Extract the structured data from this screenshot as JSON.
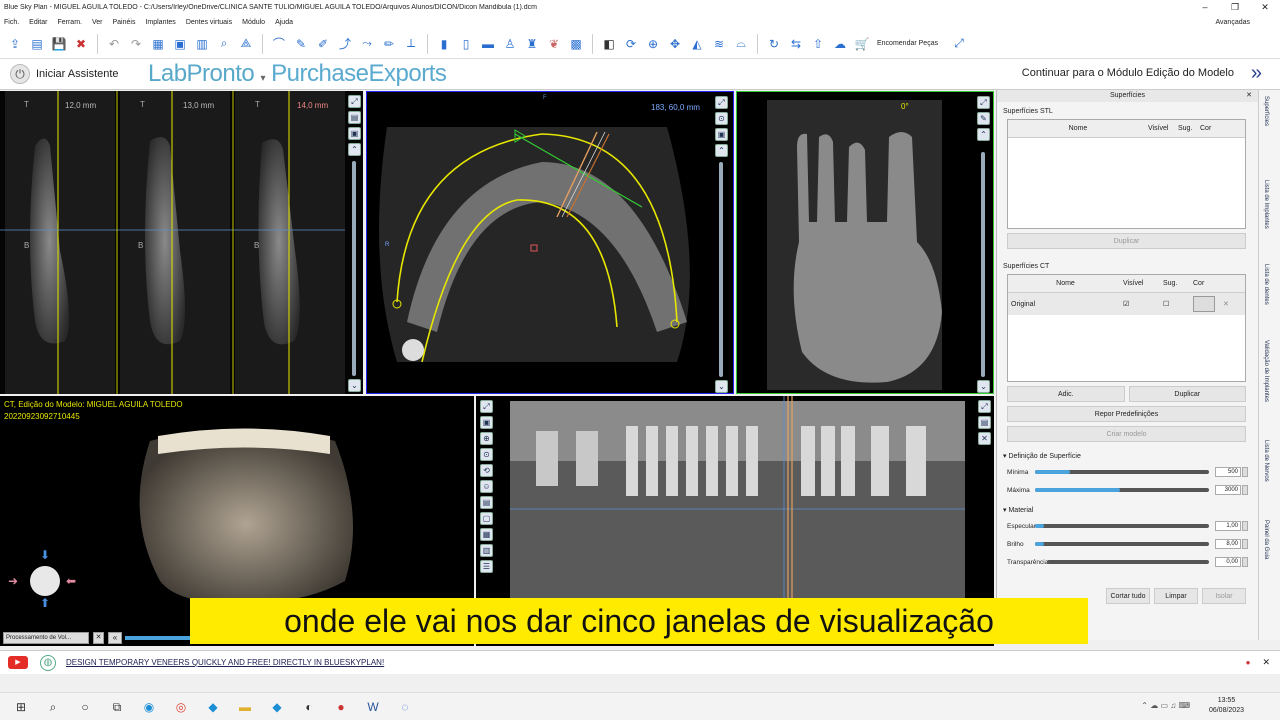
{
  "window": {
    "title": "Blue Sky Plan - MIGUEL AGUILA TOLEDO - C:/Users/Irley/OneDrive/CLINICA SANTÉ TULIO/MIGUEL AGUILA TOLEDO/Arquivos Alunos/DICON/Dicon Mandibula (1).dcm"
  },
  "menu": {
    "items": [
      "Fich.",
      "Editar",
      "Ferram.",
      "Ver",
      "Painéis",
      "Implantes",
      "Dentes virtuais",
      "Módulo",
      "Ajuda"
    ],
    "advanced": "Avançadas"
  },
  "toolbar": {
    "order_parts": "Encomendar Peças"
  },
  "assistant": {
    "start": "Iniciar Assistente",
    "brand1": "LabPronto",
    "brand2": "PurchaseExports",
    "continue": "Continuar para o Módulo Edição do Modelo"
  },
  "views": {
    "cross": {
      "labels": [
        "12,0 mm",
        "13,0 mm",
        "14,0 mm"
      ],
      "t": "T",
      "b": "B"
    },
    "axial": {
      "top": "F",
      "coord": "183, 60,0 mm",
      "side": "R"
    },
    "sagittal": {
      "angle": "0°"
    },
    "model": {
      "line1": "CT, Edição do Modelo: MIGUEL AGUILA TOLEDO",
      "line2": "20220923092710445",
      "proc": "Processamento de Vol..."
    }
  },
  "panel": {
    "title": "Superfícies",
    "stl_title": "Superfícies STL",
    "cols": [
      "Nome",
      "Visível",
      "Sug.",
      "Cor"
    ],
    "dup1": "Duplicar",
    "ct_title": "Superfícies CT",
    "ct_row": "Original",
    "add": "Adic.",
    "dup2": "Duplicar",
    "reset": "Repor Predefinições",
    "create": "Criar modelo",
    "surface_def": "Definição de Superfície",
    "min_label": "Mínima",
    "min_value": "500",
    "min_level": 0.2,
    "max_label": "Máxima",
    "max_value": "3000",
    "max_level": 0.49,
    "material": "Material",
    "spec_label": "Especular",
    "spec_value": "1,00",
    "spec_level": 0.05,
    "bright_label": "Brilho",
    "bright_value": "8,00",
    "bright_level": 0.05,
    "transp_label": "Transparência",
    "transp_value": "0,00",
    "transp_level": 0.0,
    "cut_all": "Cortar tudo",
    "clean": "Limpar",
    "isolate": "Isolar"
  },
  "rtabs": [
    "Superfícies",
    "Lista de Implantes",
    "Lista de dentes",
    "Validação de Implantes",
    "Lista de Nervos",
    "Painel da Guia"
  ],
  "subtitle": "onde ele vai nos dar cinco janelas de visualização",
  "status": {
    "link": "DESIGN TEMPORARY VENEERS QUICKLY AND FREE! DIRECTLY IN BLUESKYPLAN!"
  },
  "clock": {
    "time": "13:55",
    "date": "06/08/2023"
  },
  "colors": {
    "accent": "#58a9c9",
    "subtitle_bg": "#ffeb00",
    "arch": "#e6e600",
    "ruler_green": "#33cc33"
  }
}
